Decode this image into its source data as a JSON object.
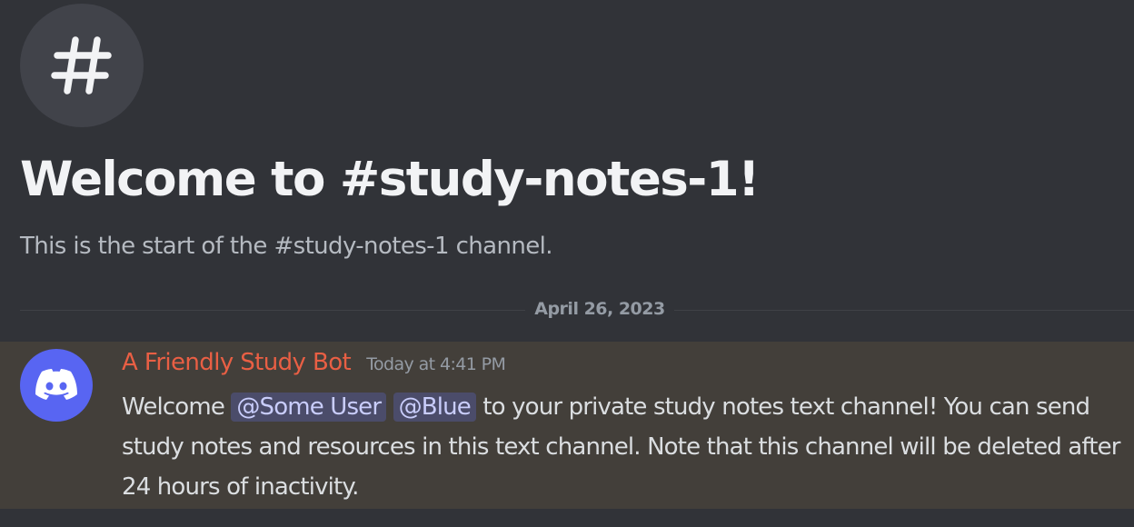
{
  "channel": {
    "icon": "hash-icon",
    "welcome_title": "Welcome to #study-notes-1!",
    "welcome_subtitle": "This is the start of the #study-notes-1 channel."
  },
  "divider": {
    "date": "April 26, 2023"
  },
  "message": {
    "avatar_icon": "discord-logo-icon",
    "author": "A Friendly Study Bot",
    "timestamp": "Today at 4:41 PM",
    "text_prefix": "Welcome ",
    "mentions": [
      "@Some User",
      "@Blue"
    ],
    "text_suffix": " to your private study notes text channel! You can send study notes and resources in this text channel. Note that this channel will be deleted after 24 hours of inactivity."
  },
  "colors": {
    "background": "#313338",
    "message_highlight": "#433f3a",
    "author_name": "#e95f44",
    "mention_bg": "#4b4c6a",
    "avatar_bg": "#5865f2"
  }
}
